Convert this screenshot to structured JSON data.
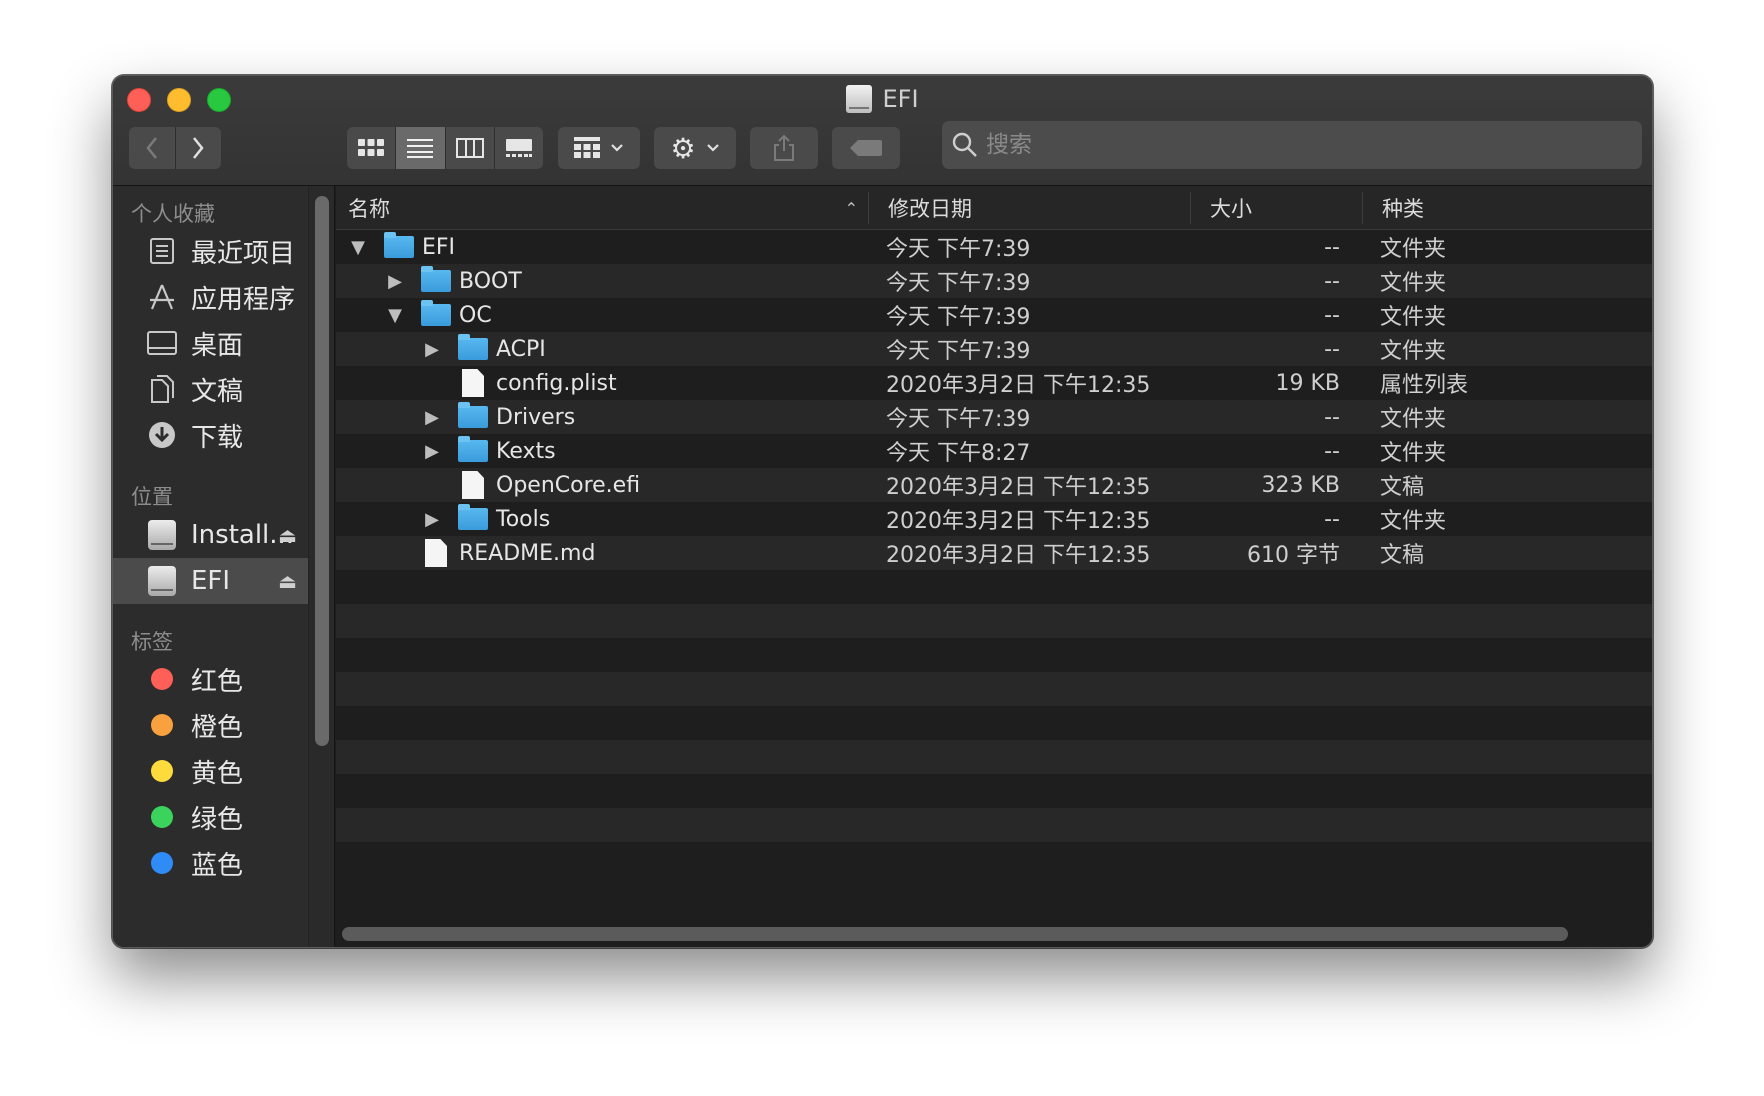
{
  "window": {
    "title": "EFI"
  },
  "toolbar": {
    "back": "‹",
    "forward": "›",
    "search_placeholder": "搜索"
  },
  "sidebar": {
    "favorites_header": "个人收藏",
    "favorites": [
      {
        "label": "最近项目",
        "icon": "recents-icon"
      },
      {
        "label": "应用程序",
        "icon": "applications-icon"
      },
      {
        "label": "桌面",
        "icon": "desktop-icon"
      },
      {
        "label": "文稿",
        "icon": "documents-icon"
      },
      {
        "label": "下载",
        "icon": "downloads-icon"
      }
    ],
    "locations_header": "位置",
    "locations": [
      {
        "label": "Install...",
        "icon": "drive-icon"
      },
      {
        "label": "EFI",
        "icon": "drive-icon",
        "selected": true
      }
    ],
    "tags_header": "标签",
    "tags": [
      {
        "label": "红色",
        "color": "#fe5f57"
      },
      {
        "label": "橙色",
        "color": "#f9a03f"
      },
      {
        "label": "黄色",
        "color": "#fedb3c"
      },
      {
        "label": "绿色",
        "color": "#3bd35c"
      },
      {
        "label": "蓝色",
        "color": "#2f8cf6"
      }
    ]
  },
  "columns": {
    "name": "名称",
    "date": "修改日期",
    "size": "大小",
    "kind": "种类"
  },
  "rows": [
    {
      "name": "EFI",
      "type": "folder",
      "level": 0,
      "disclosure": "open",
      "date": "今天 下午7:39",
      "size": "--",
      "kind": "文件夹"
    },
    {
      "name": "BOOT",
      "type": "folder",
      "level": 1,
      "disclosure": "closed",
      "date": "今天 下午7:39",
      "size": "--",
      "kind": "文件夹"
    },
    {
      "name": "OC",
      "type": "folder",
      "level": 1,
      "disclosure": "open",
      "date": "今天 下午7:39",
      "size": "--",
      "kind": "文件夹"
    },
    {
      "name": "ACPI",
      "type": "folder",
      "level": 2,
      "disclosure": "closed",
      "date": "今天 下午7:39",
      "size": "--",
      "kind": "文件夹"
    },
    {
      "name": "config.plist",
      "type": "file",
      "level": 2,
      "disclosure": "none",
      "date": "2020年3月2日 下午12:35",
      "size": "19 KB",
      "kind": "属性列表"
    },
    {
      "name": "Drivers",
      "type": "folder",
      "level": 2,
      "disclosure": "closed",
      "date": "今天 下午7:39",
      "size": "--",
      "kind": "文件夹"
    },
    {
      "name": "Kexts",
      "type": "folder",
      "level": 2,
      "disclosure": "closed",
      "date": "今天 下午8:27",
      "size": "--",
      "kind": "文件夹"
    },
    {
      "name": "OpenCore.efi",
      "type": "file",
      "level": 2,
      "disclosure": "none",
      "date": "2020年3月2日 下午12:35",
      "size": "323 KB",
      "kind": "文稿"
    },
    {
      "name": "Tools",
      "type": "folder",
      "level": 2,
      "disclosure": "closed",
      "date": "2020年3月2日 下午12:35",
      "size": "--",
      "kind": "文件夹"
    },
    {
      "name": "README.md",
      "type": "file",
      "level": 1,
      "disclosure": "none",
      "date": "2020年3月2日 下午12:35",
      "size": "610 字节",
      "kind": "文稿"
    }
  ]
}
